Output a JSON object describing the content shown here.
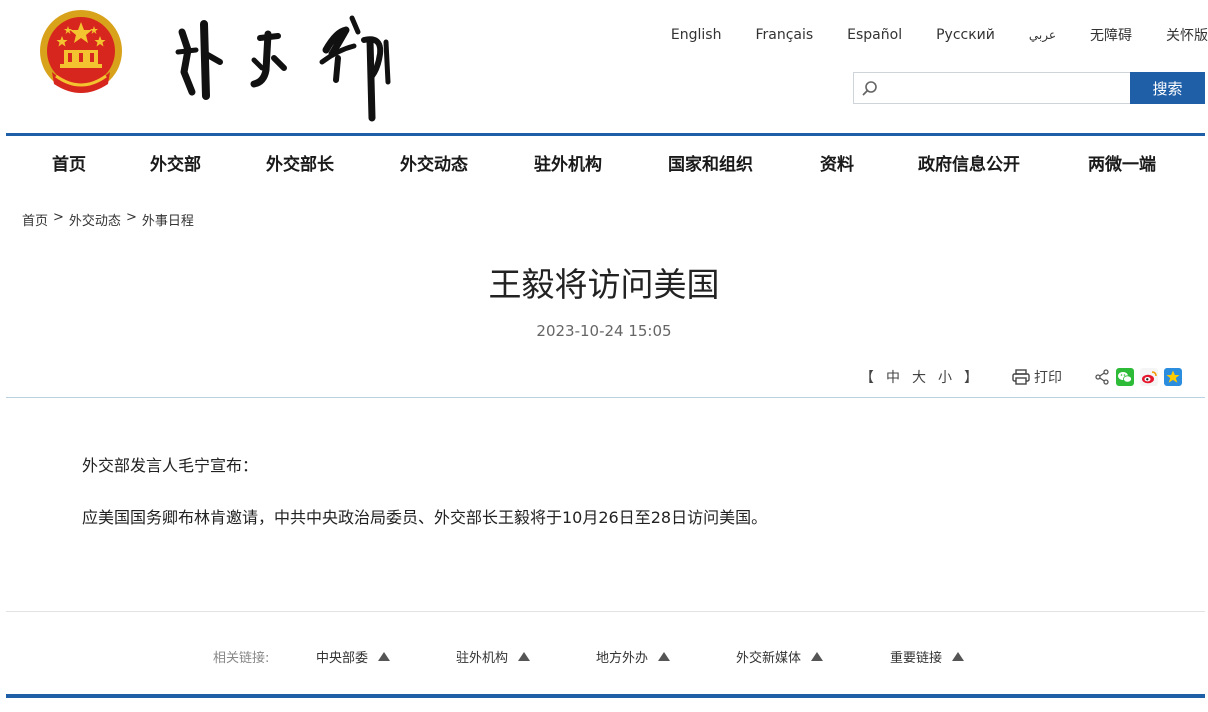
{
  "header": {
    "languages": [
      "English",
      "Français",
      "Español",
      "Русский",
      "عربي",
      "无障碍",
      "关怀版"
    ],
    "search": {
      "placeholder": "",
      "button_label": "搜索"
    }
  },
  "nav": {
    "items": [
      "首页",
      "外交部",
      "外交部长",
      "外交动态",
      "驻外机构",
      "国家和组织",
      "资料",
      "政府信息公开",
      "两微一端"
    ]
  },
  "breadcrumb": [
    "首页",
    ">",
    "外交动态",
    ">",
    "外事日程"
  ],
  "article": {
    "title": "王毅将访问美国",
    "date": "2023-10-24 15:05",
    "paragraphs": [
      "外交部发言人毛宁宣布：",
      "应美国国务卿布林肯邀请，中共中央政治局委员、外交部长王毅将于10月26日至28日访问美国。"
    ]
  },
  "tools": {
    "font_open": "【",
    "font_medium": "中",
    "font_large": "大",
    "font_small": "小",
    "font_close": "】",
    "print_label": "打印"
  },
  "footer": {
    "label": "相关链接:",
    "links": [
      "中央部委",
      "驻外机构",
      "地方外办",
      "外交新媒体",
      "重要链接"
    ]
  },
  "colors": {
    "brand_blue": "#1f5fa8",
    "emblem_red": "#d7261e",
    "emblem_gold": "#f4c430",
    "divider_light": "#b9d3e3"
  }
}
